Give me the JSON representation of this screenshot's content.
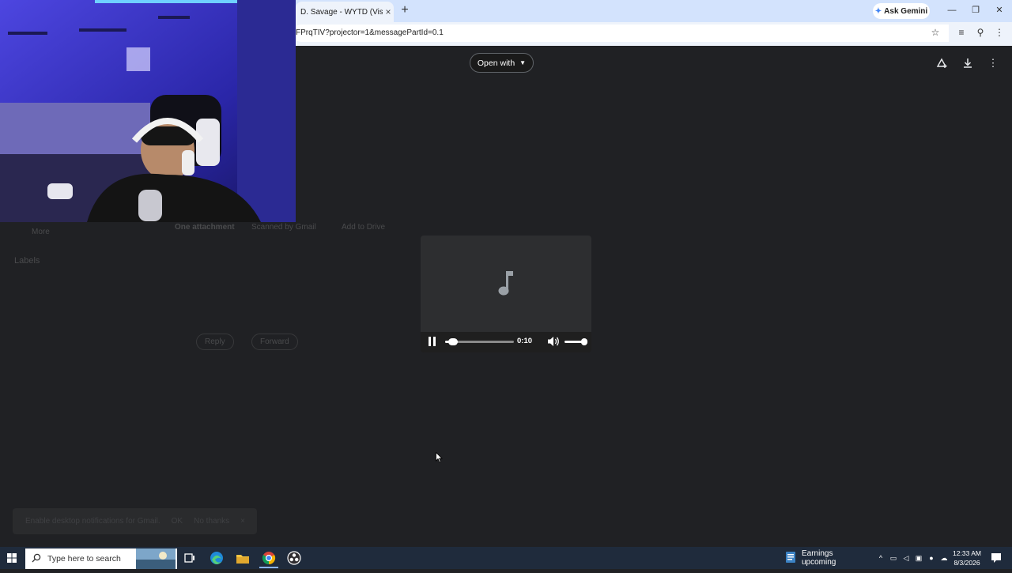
{
  "browser": {
    "tab_title": "D. Savage - WYTD (Visualiz",
    "tab_close": "×",
    "new_tab": "+",
    "ask_gemini_label": "Ask Gemini",
    "address": "FPrqTIV?projector=1&messagePartId=0.1"
  },
  "viewer": {
    "open_with_label": "Open with",
    "player": {
      "time": "0:10",
      "progress_fraction": 0.12,
      "volume_fraction": 0.9,
      "state": "playing"
    }
  },
  "background_gmail": {
    "attachment_heading": "One attachment",
    "scanned_label": "Scanned by Gmail",
    "add_to_drive": "Add to Drive",
    "labels_heading": "Labels",
    "reply": "Reply",
    "forward": "Forward",
    "more_label": "More"
  },
  "toast": {
    "message": "Enable desktop notifications for Gmail.",
    "ok": "OK",
    "no_thanks": "No thanks",
    "close": "×"
  },
  "taskbar": {
    "search_placeholder": "Type here to search",
    "widget_label": "Earnings upcoming",
    "time": "12:33 AM",
    "date": "8/3/2026"
  },
  "colors": {
    "chrome_frame": "#d3e3fd",
    "viewer_bg": "#202124",
    "taskbar": "#1f2b3c",
    "webcam_light": "#3d3ad6"
  }
}
